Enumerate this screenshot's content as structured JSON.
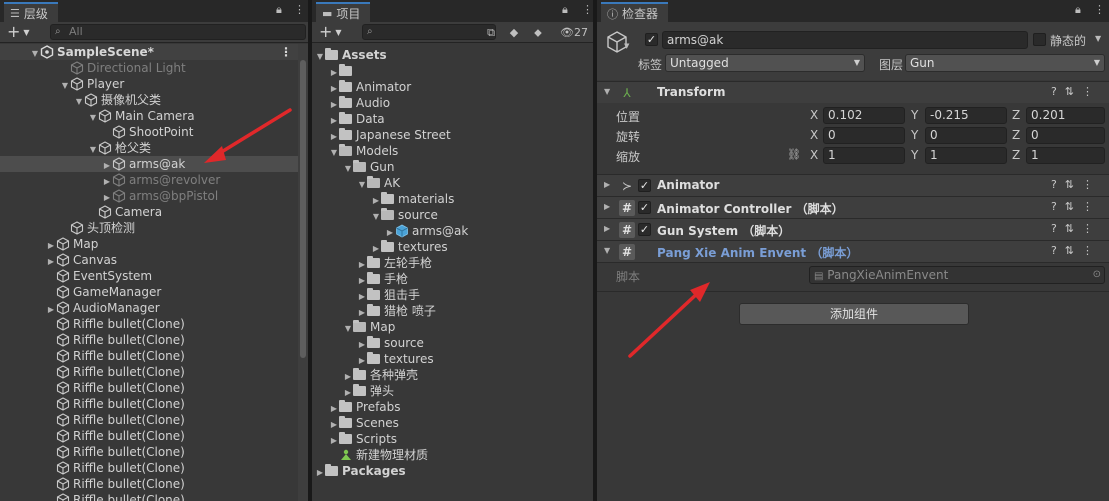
{
  "hierarchy": {
    "tab_label": "层级",
    "search_placeholder": "All",
    "rows": [
      {
        "label": "SampleScene*",
        "indent": 0,
        "arrow": "▼",
        "kind": "scene"
      },
      {
        "label": "Directional Light",
        "indent": 1,
        "arrow": "",
        "kind": "dim"
      },
      {
        "label": "Player",
        "indent": 1,
        "arrow": "▼",
        "kind": "obj"
      },
      {
        "label": "摄像机父类",
        "indent": 2,
        "arrow": "▼",
        "kind": "obj"
      },
      {
        "label": "Main Camera",
        "indent": 3,
        "arrow": "▼",
        "kind": "obj"
      },
      {
        "label": "ShootPoint",
        "indent": 4,
        "arrow": "",
        "kind": "obj"
      },
      {
        "label": "枪父类",
        "indent": 3,
        "arrow": "▼",
        "kind": "obj"
      },
      {
        "label": "arms@ak",
        "indent": 4,
        "arrow": "▶",
        "kind": "sel"
      },
      {
        "label": "arms@revolver",
        "indent": 4,
        "arrow": "▶",
        "kind": "dim"
      },
      {
        "label": "arms@bpPistol",
        "indent": 4,
        "arrow": "▶",
        "kind": "dim"
      },
      {
        "label": "Camera",
        "indent": 3,
        "arrow": "",
        "kind": "obj"
      },
      {
        "label": "头顶检测",
        "indent": 1,
        "arrow": "",
        "kind": "obj"
      },
      {
        "label": "Map",
        "indent": 0,
        "arrow": "▶",
        "kind": "obj"
      },
      {
        "label": "Canvas",
        "indent": 0,
        "arrow": "▶",
        "kind": "obj"
      },
      {
        "label": "EventSystem",
        "indent": 0,
        "arrow": "",
        "kind": "obj"
      },
      {
        "label": "GameManager",
        "indent": 0,
        "arrow": "",
        "kind": "obj"
      },
      {
        "label": "AudioManager",
        "indent": 0,
        "arrow": "▶",
        "kind": "obj"
      },
      {
        "label": "Riffle bullet(Clone)",
        "indent": 0,
        "arrow": "",
        "kind": "obj"
      },
      {
        "label": "Riffle bullet(Clone)",
        "indent": 0,
        "arrow": "",
        "kind": "obj"
      },
      {
        "label": "Riffle bullet(Clone)",
        "indent": 0,
        "arrow": "",
        "kind": "obj"
      },
      {
        "label": "Riffle bullet(Clone)",
        "indent": 0,
        "arrow": "",
        "kind": "obj"
      },
      {
        "label": "Riffle bullet(Clone)",
        "indent": 0,
        "arrow": "",
        "kind": "obj"
      },
      {
        "label": "Riffle bullet(Clone)",
        "indent": 0,
        "arrow": "",
        "kind": "obj"
      },
      {
        "label": "Riffle bullet(Clone)",
        "indent": 0,
        "arrow": "",
        "kind": "obj"
      },
      {
        "label": "Riffle bullet(Clone)",
        "indent": 0,
        "arrow": "",
        "kind": "obj"
      },
      {
        "label": "Riffle bullet(Clone)",
        "indent": 0,
        "arrow": "",
        "kind": "obj"
      },
      {
        "label": "Riffle bullet(Clone)",
        "indent": 0,
        "arrow": "",
        "kind": "obj"
      },
      {
        "label": "Riffle bullet(Clone)",
        "indent": 0,
        "arrow": "",
        "kind": "obj"
      },
      {
        "label": "Riffle bullet(Clone)",
        "indent": 0,
        "arrow": "",
        "kind": "obj"
      },
      {
        "label": "Riffle bullet(Clone)",
        "indent": 0,
        "arrow": "",
        "kind": "obj"
      }
    ]
  },
  "project": {
    "tab_label": "项目",
    "hidden_count": "27",
    "rows": [
      {
        "label": "Assets",
        "indent": 0,
        "arrow": "▼",
        "kind": "bold-folder"
      },
      {
        "label": "",
        "indent": 1,
        "arrow": "▶",
        "kind": "folder"
      },
      {
        "label": "Animator",
        "indent": 1,
        "arrow": "▶",
        "kind": "folder"
      },
      {
        "label": "Audio",
        "indent": 1,
        "arrow": "▶",
        "kind": "folder"
      },
      {
        "label": "Data",
        "indent": 1,
        "arrow": "▶",
        "kind": "folder"
      },
      {
        "label": "Japanese Street",
        "indent": 1,
        "arrow": "▶",
        "kind": "folder"
      },
      {
        "label": "Models",
        "indent": 1,
        "arrow": "▼",
        "kind": "open"
      },
      {
        "label": "Gun",
        "indent": 2,
        "arrow": "▼",
        "kind": "open"
      },
      {
        "label": "AK",
        "indent": 3,
        "arrow": "▼",
        "kind": "open"
      },
      {
        "label": "materials",
        "indent": 4,
        "arrow": "▶",
        "kind": "folder"
      },
      {
        "label": "source",
        "indent": 4,
        "arrow": "▼",
        "kind": "open"
      },
      {
        "label": "arms@ak",
        "indent": 5,
        "arrow": "▶",
        "kind": "model"
      },
      {
        "label": "textures",
        "indent": 4,
        "arrow": "▶",
        "kind": "folder"
      },
      {
        "label": "左轮手枪",
        "indent": 3,
        "arrow": "▶",
        "kind": "folder"
      },
      {
        "label": "手枪",
        "indent": 3,
        "arrow": "▶",
        "kind": "folder"
      },
      {
        "label": "狙击手",
        "indent": 3,
        "arrow": "▶",
        "kind": "folder"
      },
      {
        "label": "猎枪 喷子",
        "indent": 3,
        "arrow": "▶",
        "kind": "folder"
      },
      {
        "label": "Map",
        "indent": 2,
        "arrow": "▼",
        "kind": "open"
      },
      {
        "label": "source",
        "indent": 3,
        "arrow": "▶",
        "kind": "folder"
      },
      {
        "label": "textures",
        "indent": 3,
        "arrow": "▶",
        "kind": "folder"
      },
      {
        "label": "各种弹壳",
        "indent": 2,
        "arrow": "▶",
        "kind": "folder"
      },
      {
        "label": "弹头",
        "indent": 2,
        "arrow": "▶",
        "kind": "folder"
      },
      {
        "label": "Prefabs",
        "indent": 1,
        "arrow": "▶",
        "kind": "folder"
      },
      {
        "label": "Scenes",
        "indent": 1,
        "arrow": "▶",
        "kind": "folder"
      },
      {
        "label": "Scripts",
        "indent": 1,
        "arrow": "▶",
        "kind": "folder"
      },
      {
        "label": "新建物理材质",
        "indent": 1,
        "arrow": "",
        "kind": "physmat"
      },
      {
        "label": "Packages",
        "indent": 0,
        "arrow": "▶",
        "kind": "bold-folder"
      }
    ]
  },
  "inspector": {
    "tab_label": "检查器",
    "object_name": "arms@ak",
    "static_label": "静态的",
    "tag_label": "标签",
    "tag_value": "Untagged",
    "layer_label": "图层",
    "layer_value": "Gun",
    "transform": {
      "name": "Transform",
      "position_label": "位置",
      "rotation_label": "旋转",
      "scale_label": "缩放",
      "position": {
        "x": "0.102",
        "y": "-0.215",
        "z": "0.201"
      },
      "rotation": {
        "x": "0",
        "y": "0",
        "z": "0"
      },
      "scale": {
        "x": "1",
        "y": "1",
        "z": "1"
      }
    },
    "components": {
      "animator": "Animator",
      "animator_controller": "Animator Controller （脚本）",
      "gun_system": "Gun System （脚本）",
      "pang_xie": "Pang Xie Anim Envent （脚本）"
    },
    "script_label": "脚本",
    "script_value": "PangXieAnimEnvent",
    "add_component": "添加组件",
    "colors": {
      "highlight_name": "#7a9ed6",
      "tab_accent": "#3a79bb",
      "arrow": "#e0282a"
    }
  }
}
